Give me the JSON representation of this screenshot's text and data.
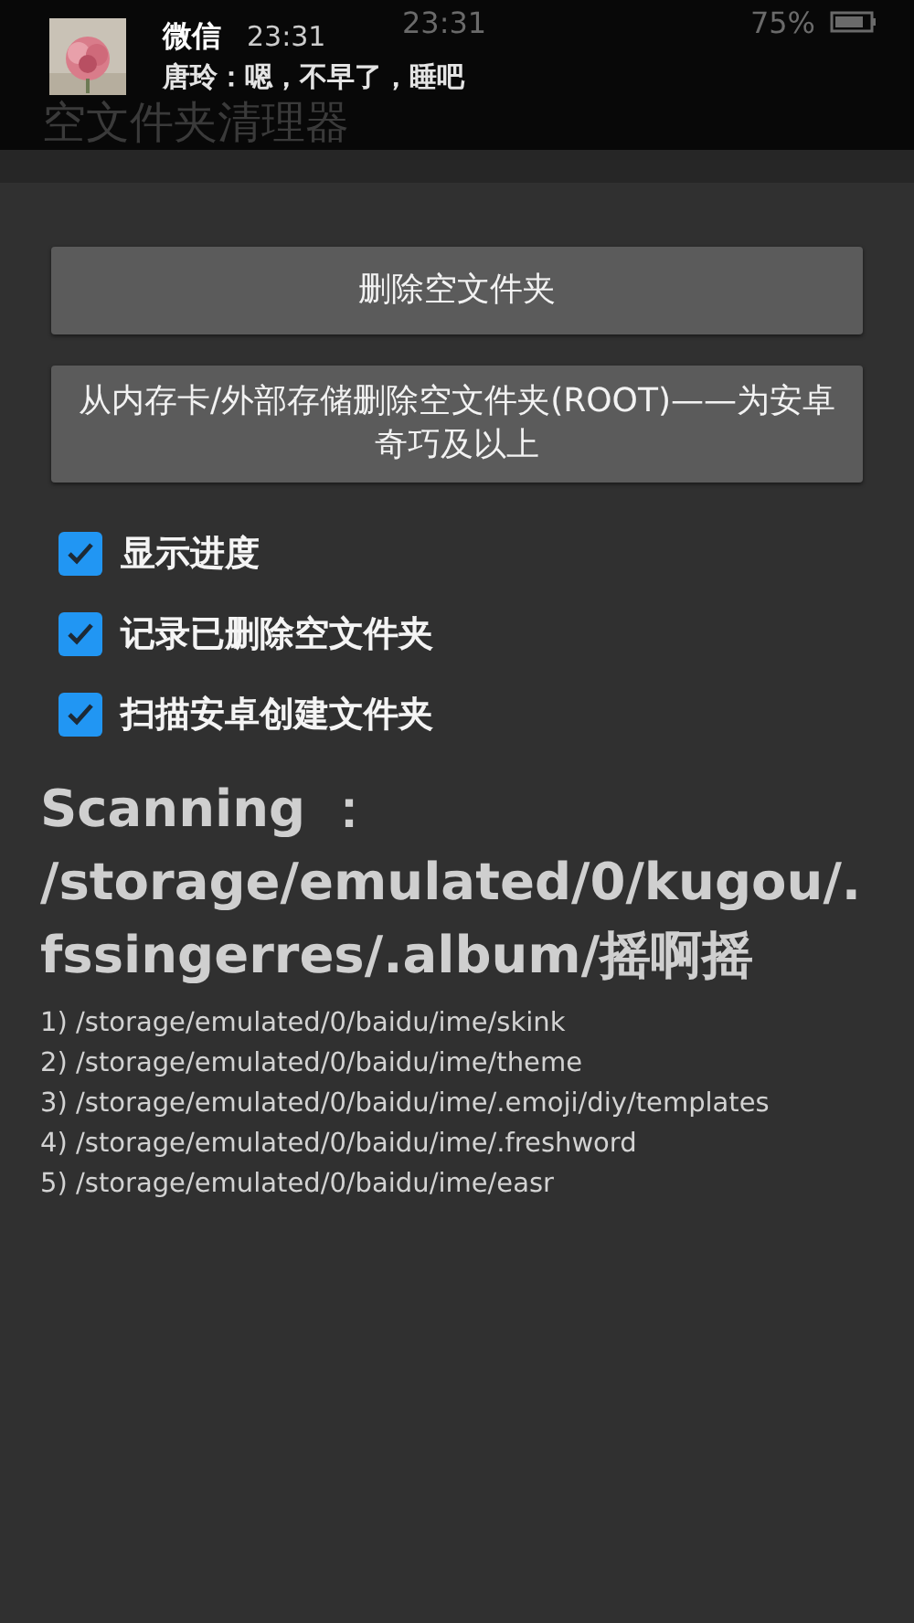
{
  "status_bar": {
    "time": "23:31",
    "battery": "75%"
  },
  "notification": {
    "app": "微信",
    "time": "23:31",
    "message": "唐玲：嗯，不早了，睡吧"
  },
  "app_title": "空文件夹清理器",
  "buttons": [
    "删除空文件夹",
    "从内存卡/外部存储删除空文件夹(ROOT)——为安卓奇巧及以上"
  ],
  "options": [
    {
      "label": "显示进度",
      "checked": true
    },
    {
      "label": "记录已删除空文件夹",
      "checked": true
    },
    {
      "label": "扫描安卓创建文件夹",
      "checked": true
    }
  ],
  "scan": {
    "label": "Scanning ：",
    "path_lines": [
      "/storage/emulated/0/kugou/.",
      "fssingerres/.album/摇啊摇"
    ]
  },
  "results": [
    {
      "number": "1)",
      "path": "/storage/emulated/0/baidu/ime/skink"
    },
    {
      "number": "2)",
      "path": "/storage/emulated/0/baidu/ime/theme"
    },
    {
      "number": "3)",
      "path": "/storage/emulated/0/baidu/ime/.emoji/diy/templates"
    },
    {
      "number": "4)",
      "path": "/storage/emulated/0/baidu/ime/.freshword"
    },
    {
      "number": "5)",
      "path": "/storage/emulated/0/baidu/ime/easr"
    }
  ]
}
